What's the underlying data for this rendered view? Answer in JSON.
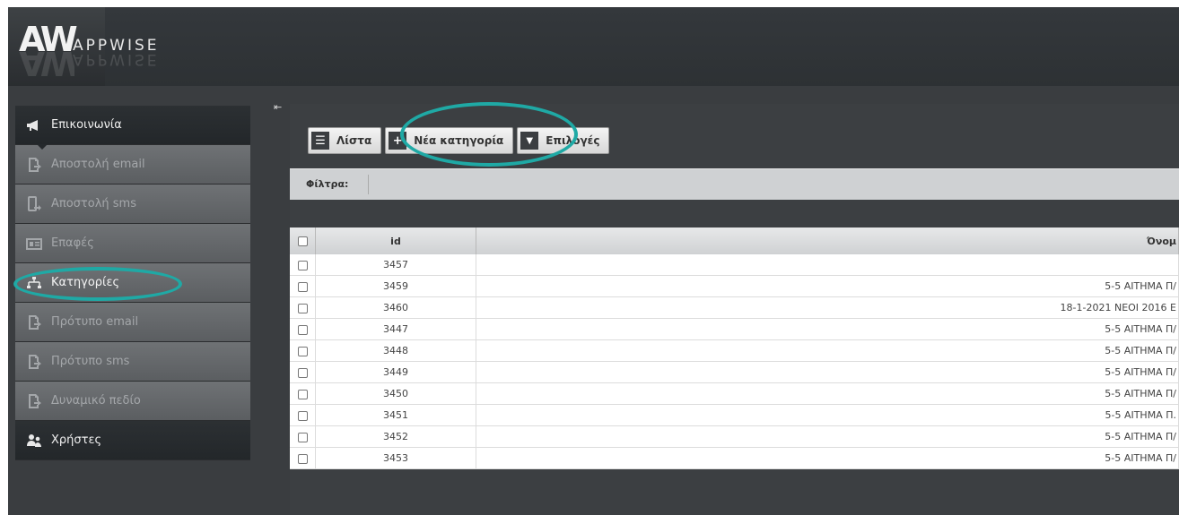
{
  "header": {
    "brand_mark": "AW",
    "brand_name": "APPWISE"
  },
  "sidebar": {
    "items": [
      {
        "label": "Επικοινωνία",
        "icon": "megaphone-icon"
      },
      {
        "label": "Αποστολή email",
        "icon": "document-arrow-icon"
      },
      {
        "label": "Αποστολή sms",
        "icon": "phone-send-icon"
      },
      {
        "label": "Επαφές",
        "icon": "contacts-card-icon"
      },
      {
        "label": "Κατηγορίες",
        "icon": "hierarchy-icon"
      },
      {
        "label": "Πρότυπο email",
        "icon": "document-arrow-icon"
      },
      {
        "label": "Πρότυπο sms",
        "icon": "document-arrow-icon"
      },
      {
        "label": "Δυναμικό πεδίο",
        "icon": "document-arrow-icon"
      },
      {
        "label": "Χρήστες",
        "icon": "users-icon"
      }
    ],
    "collapse_glyph": "⇤"
  },
  "toolbar": {
    "list_label": "Λίστα",
    "new_label": "Νέα κατηγορία",
    "options_label": "Επιλογές"
  },
  "filter": {
    "label": "Φίλτρα:"
  },
  "table": {
    "headers": {
      "id": "id",
      "name": "Όνομ"
    },
    "rows": [
      {
        "id": "3457",
        "name": ""
      },
      {
        "id": "3459",
        "name": "5-5 ΑΙΤΗΜΑ Π/"
      },
      {
        "id": "3460",
        "name": "18-1-2021 ΝΕΟΙ 2016 Ε"
      },
      {
        "id": "3447",
        "name": "5-5 ΑΙΤΗΜΑ Π/"
      },
      {
        "id": "3448",
        "name": "5-5 ΑΙΤΗΜΑ Π/"
      },
      {
        "id": "3449",
        "name": "5-5 ΑΙΤΗΜΑ Π/"
      },
      {
        "id": "3450",
        "name": "5-5 ΑΙΤΗΜΑ Π/"
      },
      {
        "id": "3451",
        "name": "5-5 ΑΙΤΗΜΑ Π."
      },
      {
        "id": "3452",
        "name": "5-5 ΑΙΤΗΜΑ Π/"
      },
      {
        "id": "3453",
        "name": "5-5 ΑΙΤΗΜΑ Π/"
      }
    ]
  },
  "colors": {
    "highlight": "#1fa9a5",
    "header_bg": "#2d3134",
    "sidebar_item": "#646769",
    "sidebar_dark": "#25292c"
  }
}
